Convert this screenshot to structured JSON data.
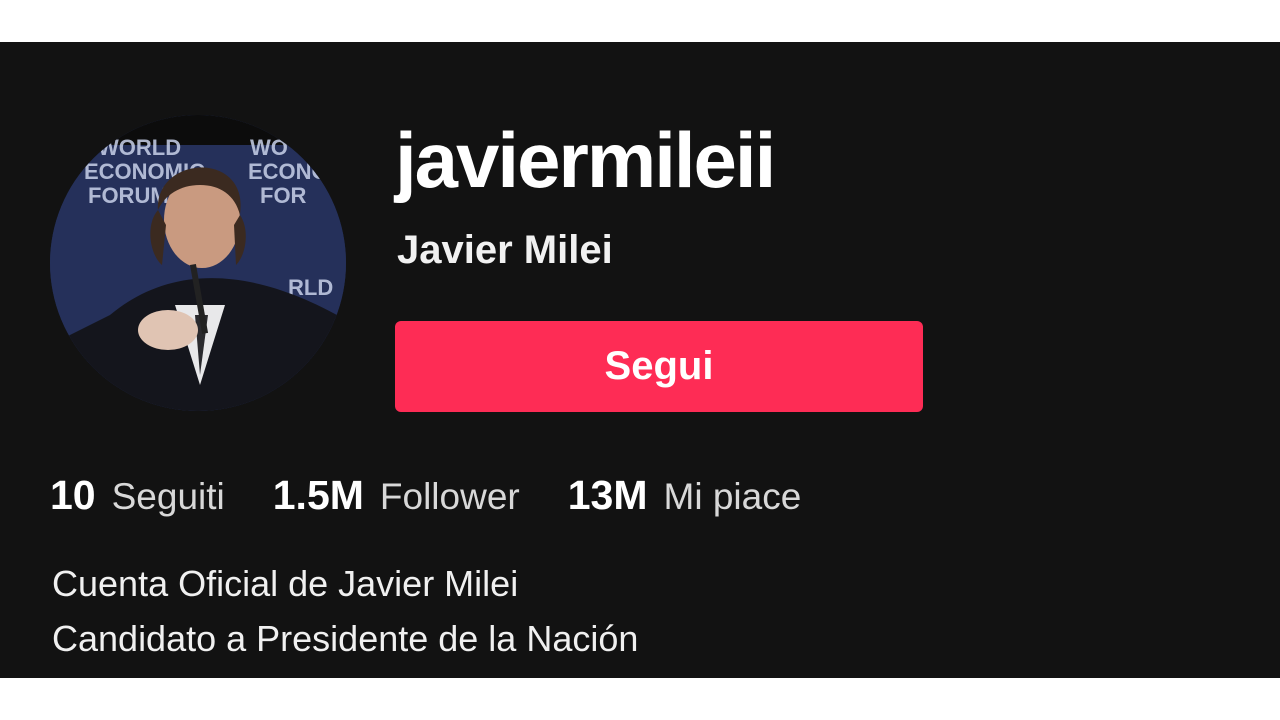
{
  "profile": {
    "username": "javiermileii",
    "display_name": "Javier Milei",
    "follow_label": "Segui",
    "avatar_logo_text": "WORLD ECONOMIC FORUM"
  },
  "stats": [
    {
      "value": "10",
      "label": "Seguiti"
    },
    {
      "value": "1.5M",
      "label": "Follower"
    },
    {
      "value": "13M",
      "label": "Mi piace"
    }
  ],
  "bio": {
    "lines": [
      "Cuenta Oficial de Javier Milei",
      "Candidato a Presidente de la Nación"
    ]
  },
  "colors": {
    "background": "#121212",
    "accent": "#fe2c55",
    "text": "#ffffff"
  }
}
